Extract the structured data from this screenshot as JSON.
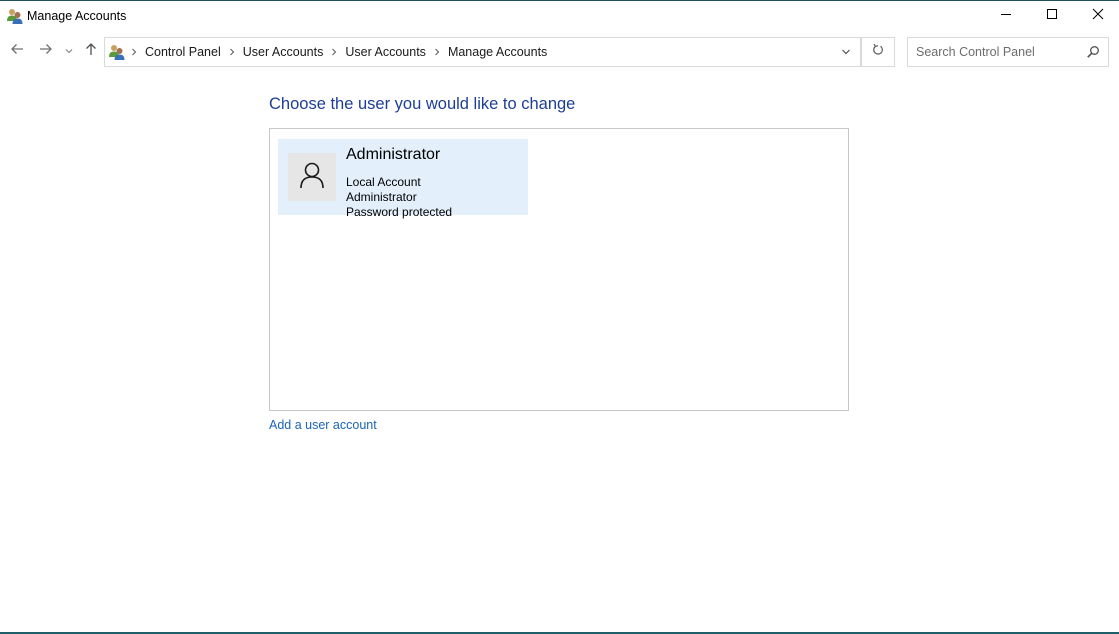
{
  "window": {
    "title": "Manage Accounts",
    "icon": "user-accounts-icon",
    "controls": {
      "minimize": "minimize-icon",
      "maximize": "maximize-icon",
      "close": "close-icon"
    }
  },
  "navigation": {
    "back": "back-arrow-icon",
    "forward": "forward-arrow-icon",
    "recent": "chevron-down-icon",
    "up": "up-arrow-icon",
    "breadcrumbs": [
      {
        "label": "Control Panel"
      },
      {
        "label": "User Accounts"
      },
      {
        "label": "User Accounts"
      },
      {
        "label": "Manage Accounts"
      }
    ],
    "search": {
      "placeholder": "Search Control Panel",
      "value": ""
    }
  },
  "main": {
    "heading": "Choose the user you would like to change",
    "accounts": [
      {
        "name": "Administrator",
        "type": "Local Account",
        "role": "Administrator",
        "password_status": "Password protected",
        "selected": true
      }
    ],
    "add_account_link": "Add a user account"
  },
  "colors": {
    "heading": "#1c3f94",
    "link": "#1a64b4",
    "selected_tile": "#e3f0fb",
    "window_border": "#1f5f6a"
  }
}
